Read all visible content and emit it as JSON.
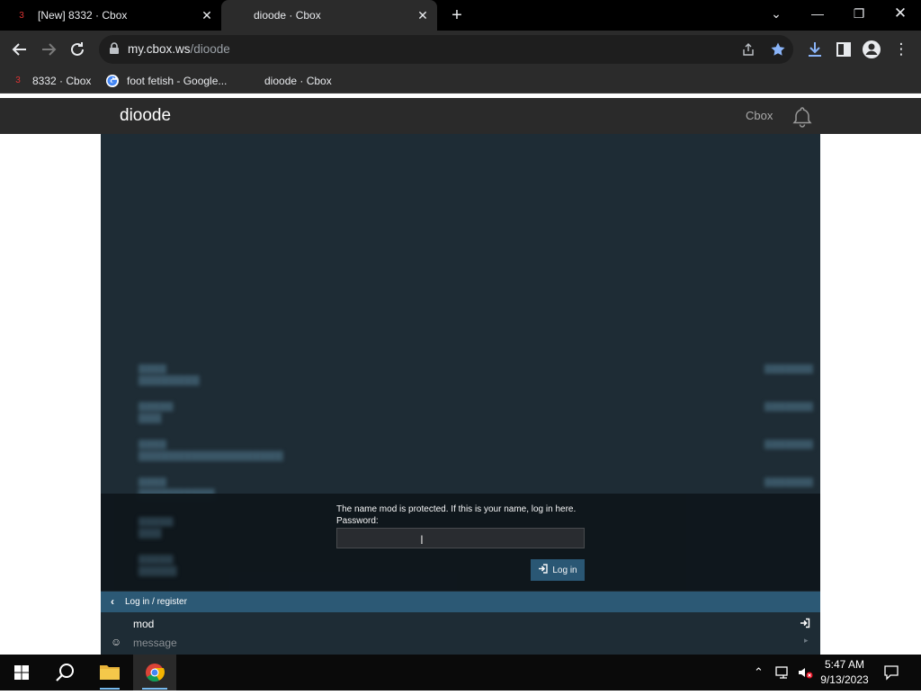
{
  "browser": {
    "tabs": [
      {
        "badge": "3",
        "title": "[New] 8332 · Cbox",
        "active": false
      },
      {
        "title": "dioode · Cbox",
        "active": true
      }
    ],
    "url_host": "my.cbox.ws",
    "url_path": "/dioode",
    "bookmarks": [
      {
        "badge": "3",
        "label": "8332 · Cbox"
      },
      {
        "label": "foot fetish - Google..."
      },
      {
        "label": "dioode · Cbox"
      }
    ]
  },
  "page": {
    "title": "dioode",
    "cbox_link": "Cbox"
  },
  "chat": {
    "login_prompt": "The name mod is protected. If this is your name, log in here.",
    "password_label": "Password:",
    "password_value": "",
    "login_button": "Log in",
    "login_register_link": "Log in / register",
    "username": "mod",
    "message_placeholder": "message"
  },
  "taskbar": {
    "time": "5:47 AM",
    "date": "9/13/2023"
  },
  "colors": {
    "chat_bg": "#1e2c35",
    "accent_blue": "#2c5975",
    "browser_chrome": "#2b2b2b"
  }
}
